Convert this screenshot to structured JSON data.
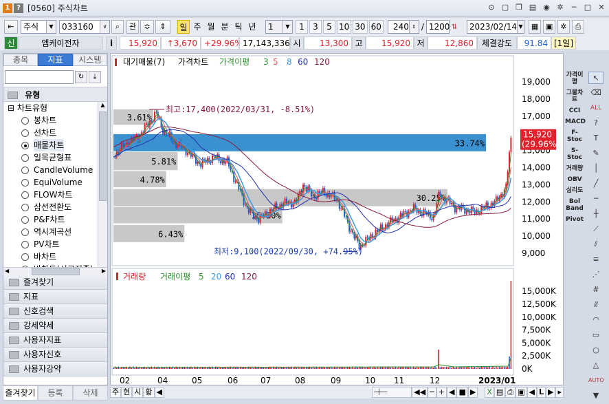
{
  "window": {
    "title": "[0560] 주식차트",
    "badge_1": "1",
    "badge_2": "?"
  },
  "toolbar": {
    "market": "주식",
    "code": "033160",
    "btn_gwan": "관",
    "periods": [
      "일",
      "주",
      "월",
      "분",
      "틱",
      "년"
    ],
    "active_period": "일",
    "interval_select": "1",
    "interval_buttons": [
      "1",
      "3",
      "5",
      "10",
      "30",
      "60"
    ],
    "count": "240",
    "count_sep": "/",
    "max_count": "1200",
    "date": "2023/02/14"
  },
  "quote": {
    "market_tag": "신",
    "name": "엠케이전자",
    "info_btn": "i",
    "price": "15,920",
    "change": "↑3,670",
    "change_pct": "+29.96%",
    "volume": "17,143,336",
    "open_label": "시",
    "open": "13,300",
    "high_label": "고",
    "high": "15,920",
    "low_label": "저",
    "low": "12,860",
    "strength_label": "체결강도",
    "strength": "91.84",
    "period_tag": "[1일]"
  },
  "left_panel": {
    "tabs": [
      "종목",
      "지표",
      "시스템"
    ],
    "active_tab": "지표",
    "section_title": "유형",
    "tree_root": "차트유형",
    "chart_types": [
      "봉차트",
      "선차트",
      "매물차트",
      "일목균형표",
      "CandleVolume",
      "EquiVolume",
      "FLOW차트",
      "삼선전환도",
      "P&F차트",
      "역시계곡선",
      "PV차트",
      "바차트",
      "바차트(시고저종)"
    ],
    "selected_type": "매물차트",
    "folders": [
      "즐겨찾기",
      "지표",
      "신호검색",
      "강세약세",
      "사용자지표",
      "사용자신호",
      "사용자강약"
    ],
    "bottom_buttons": [
      "즐겨찾기",
      "등록",
      "삭제"
    ]
  },
  "chart": {
    "price_legend": [
      "대기매물(7)",
      "가격차트",
      "가격이평",
      "3",
      "5",
      "8",
      "60",
      "120"
    ],
    "volume_legend": [
      "거래량",
      "거래이평",
      "5",
      "20",
      "60",
      "120"
    ],
    "high_annotation": "최고:17,400(2022/03/31, -8.51%)",
    "low_annotation": "최저:9,100(2022/09/30, +74.95%)",
    "current_price_tag": "15,920",
    "current_pct_tag": "(29.96%)",
    "price_axis": [
      "19,000",
      "18,000",
      "17,000",
      "16,000",
      "15,000",
      "14,000",
      "13,000",
      "12,000",
      "11,000",
      "10,000",
      "9,000"
    ],
    "volume_axis": [
      "15,000K",
      "12,500K",
      "10,000K",
      "7,500K",
      "5,000K",
      "2,500K",
      "0K"
    ],
    "x_axis": [
      "02",
      "04",
      "05",
      "06",
      "07",
      "08",
      "09",
      "10",
      "11",
      "12",
      "2023/01"
    ],
    "volume_profile": [
      {
        "label": "3.61%",
        "pct": 3.61,
        "from": 16500,
        "to": 17400
      },
      {
        "label": "33.74%",
        "pct": 33.74,
        "from": 14950,
        "to": 15950
      },
      {
        "label": "5.81%",
        "pct": 5.81,
        "from": 13850,
        "to": 14900
      },
      {
        "label": "4.78%",
        "pct": 4.78,
        "from": 12850,
        "to": 13800
      },
      {
        "label": "30.25%",
        "pct": 30.25,
        "from": 11750,
        "to": 12750
      },
      {
        "label": "15.30%",
        "pct": 15.3,
        "from": 10750,
        "to": 11700
      },
      {
        "label": "6.43%",
        "pct": 6.43,
        "from": 9650,
        "to": 10650
      }
    ],
    "colors": {
      "up": "#e0202a",
      "down": "#1f5fd0",
      "ma3": "#2a8f2a",
      "ma5": "#e05a5a",
      "ma8": "#3a9ae0",
      "ma60": "#2030b0",
      "ma120": "#8a1a3a",
      "profile": "#c8c8c8",
      "profile_max": "#3b90d0"
    }
  },
  "right_indicators": [
    "가격이평",
    "그물차트",
    "CCI",
    "MACD",
    "F-Stoc",
    "S-Stoc",
    "거래량",
    "OBV",
    "심리도",
    "Bol Band",
    "Pivot"
  ],
  "statusbar": [
    "주",
    "현",
    "시",
    "황"
  ]
}
